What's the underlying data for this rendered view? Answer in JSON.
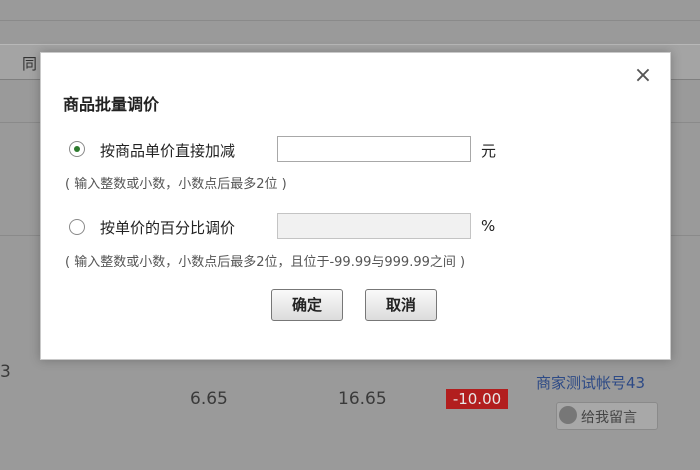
{
  "background": {
    "header_label": "同",
    "row_left_fragment": "3",
    "row_value_1": "6.65",
    "row_value_2": "16.65",
    "row_discount": "-10.00",
    "seller_link": "商家测试帐号43",
    "message_button_label": "给我留言"
  },
  "dialog": {
    "title": "商品批量调价",
    "close_label": "×",
    "option_direct": {
      "label": "按商品单价直接加减",
      "checked": true,
      "value": "",
      "unit": "元",
      "hint": "( 输入整数或小数，小数点后最多2位 )"
    },
    "option_percent": {
      "label": "按单价的百分比调价",
      "checked": false,
      "value": "",
      "unit": "%",
      "hint": "( 输入整数或小数，小数点后最多2位，且位于-99.99与999.99之间 )"
    },
    "confirm_label": "确定",
    "cancel_label": "取消"
  },
  "colors": {
    "overlay": "#9a9a9a",
    "discount_badge": "#b21e1e",
    "link": "#2d4a86",
    "radio_checked": "#2d7a2d"
  }
}
